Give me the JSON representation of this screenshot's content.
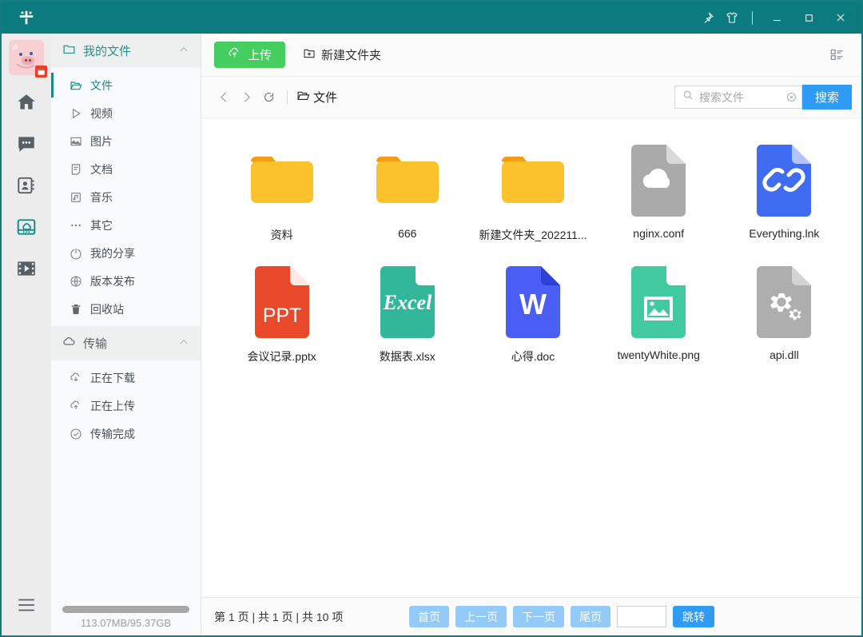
{
  "window": {
    "brand_icon": "logo-icon",
    "controls": [
      {
        "name": "pin-icon",
        "label": "置顶"
      },
      {
        "name": "skin-icon",
        "label": "换肤"
      },
      {
        "name": "minimize-icon",
        "label": "最小化"
      },
      {
        "name": "maximize-icon",
        "label": "最大化"
      },
      {
        "name": "close-icon",
        "label": "关闭"
      }
    ],
    "titlebar_color": "#0b7b7f",
    "border_color": "#137a7f"
  },
  "rail": {
    "avatar": {
      "name": "avatar",
      "badge": "calendar-badge"
    },
    "items": [
      {
        "name": "home-icon",
        "label": "主页",
        "active": false
      },
      {
        "name": "chat-icon",
        "label": "消息",
        "active": false
      },
      {
        "name": "contacts-icon",
        "label": "通讯录",
        "active": false
      },
      {
        "name": "cloud-drive-icon",
        "label": "网盘",
        "active": true
      },
      {
        "name": "video-icon",
        "label": "视频",
        "active": false
      }
    ],
    "menu": {
      "name": "menu-icon",
      "label": "菜单"
    }
  },
  "sidebar": {
    "groups": [
      {
        "title": "我的文件",
        "icon": "folder-icon",
        "collapse_icon": "chevron-up-icon",
        "accent": "#2d8c8c",
        "items": [
          {
            "label": "文件",
            "icon": "folder-open-icon",
            "active": true
          },
          {
            "label": "视频",
            "icon": "play-icon",
            "active": false
          },
          {
            "label": "图片",
            "icon": "image-icon",
            "active": false
          },
          {
            "label": "文档",
            "icon": "document-icon",
            "active": false
          },
          {
            "label": "音乐",
            "icon": "music-icon",
            "active": false
          },
          {
            "label": "其它",
            "icon": "more-icon",
            "active": false
          },
          {
            "label": "我的分享",
            "icon": "share-icon",
            "active": false
          },
          {
            "label": "版本发布",
            "icon": "globe-icon",
            "active": false
          },
          {
            "label": "回收站",
            "icon": "trash-icon",
            "active": false
          }
        ]
      },
      {
        "title": "传输",
        "icon": "cloud-icon",
        "collapse_icon": "chevron-up-icon",
        "accent": "#5b6266",
        "items": [
          {
            "label": "正在下载",
            "icon": "download-icon",
            "active": false
          },
          {
            "label": "正在上传",
            "icon": "upload-icon",
            "active": false
          },
          {
            "label": "传输完成",
            "icon": "check-circle-icon",
            "active": false
          }
        ]
      }
    ],
    "storage": {
      "text": "113.07MB/95.37GB",
      "fill_percent": 100
    }
  },
  "toolbar": {
    "upload_label": "上传",
    "upload_icon": "upload-cloud-icon",
    "upload_color": "#45ce5f",
    "new_folder_label": "新建文件夹",
    "new_folder_icon": "folder-plus-icon",
    "view_toggle_icon": "list-view-icon"
  },
  "navbar": {
    "back_icon": "chevron-left-icon",
    "forward_icon": "chevron-right-icon",
    "refresh_icon": "refresh-icon",
    "breadcrumb_icon": "folder-open-icon",
    "breadcrumb": "文件"
  },
  "search": {
    "icon": "search-icon",
    "placeholder": "搜索文件",
    "value": "",
    "clear_icon": "clear-circle-icon",
    "button_label": "搜索",
    "button_color": "#2f9bf5"
  },
  "files": [
    {
      "name": "资料",
      "type": "folder",
      "icon": "folder-icon",
      "color": "#fcc22d"
    },
    {
      "name": "666",
      "type": "folder",
      "icon": "folder-icon",
      "color": "#fcc22d"
    },
    {
      "name": "新建文件夹_202211...",
      "type": "folder",
      "icon": "folder-icon",
      "color": "#fcc22d"
    },
    {
      "name": "nginx.conf",
      "type": "file",
      "icon": "cloud-file-icon",
      "color": "#aaaaaa"
    },
    {
      "name": "Everything.lnk",
      "type": "file",
      "icon": "link-file-icon",
      "color": "#3f6cf0"
    },
    {
      "name": "会议记录.pptx",
      "type": "file",
      "icon": "ppt-file-icon",
      "color": "#e8492a",
      "badge": "PPT"
    },
    {
      "name": "数据表.xlsx",
      "type": "file",
      "icon": "excel-file-icon",
      "color": "#33b79a",
      "badge": "Excel"
    },
    {
      "name": "心得.doc",
      "type": "file",
      "icon": "word-file-icon",
      "color": "#4a5ef5",
      "badge": "W"
    },
    {
      "name": "twentyWhite.png",
      "type": "file",
      "icon": "image-file-icon",
      "color": "#41c9a0"
    },
    {
      "name": "api.dll",
      "type": "file",
      "icon": "dll-file-icon",
      "color": "#aeaeae"
    }
  ],
  "footer": {
    "page_info": "第 1 页 | 共 1 页 | 共 10 项",
    "buttons": [
      {
        "label": "首页",
        "name": "first-page-button"
      },
      {
        "label": "上一页",
        "name": "prev-page-button"
      },
      {
        "label": "下一页",
        "name": "next-page-button"
      },
      {
        "label": "尾页",
        "name": "last-page-button"
      }
    ],
    "jump_value": "",
    "jump_label": "跳转",
    "jump_color": "#2f9bf5"
  }
}
